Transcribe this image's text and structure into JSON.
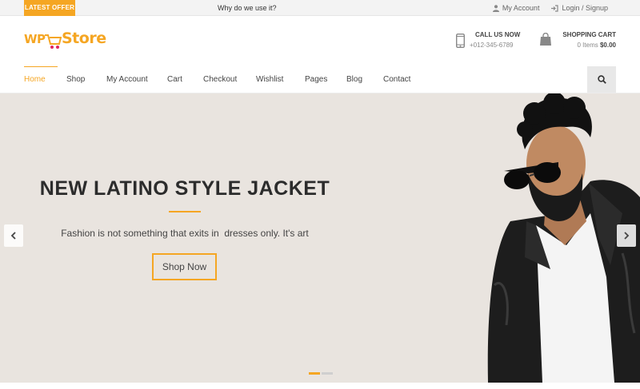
{
  "topbar": {
    "offer_badge": "LATEST OFFER",
    "ticker": "Why do we use it?",
    "my_account": "My Account",
    "login_signup": "Login / Signup"
  },
  "header": {
    "logo_wp": "WP",
    "logo_store": "Store",
    "call_title": "CALL US NOW",
    "call_phone": "+012-345-6789",
    "cart_title": "SHOPPING CART",
    "cart_items": "0 Items",
    "cart_total": "$0.00"
  },
  "nav": {
    "items": [
      "Home",
      "Shop",
      "My Account",
      "Cart",
      "Checkout",
      "Wishlist",
      "Pages",
      "Blog",
      "Contact"
    ],
    "active_index": 0
  },
  "hero": {
    "title": "NEW LATINO STYLE JACKET",
    "subtitle": "Fashion is not something that exits in  dresses only. It's art",
    "button": "Shop Now",
    "slides": 2,
    "active_slide": 0
  },
  "colors": {
    "accent": "#f5a623",
    "hero_bg": "#e9e4df"
  },
  "icons": [
    "user-icon",
    "login-icon",
    "phone-icon",
    "shopping-bag-icon",
    "search-icon",
    "chevron-left-icon",
    "chevron-right-icon",
    "cart-icon"
  ]
}
